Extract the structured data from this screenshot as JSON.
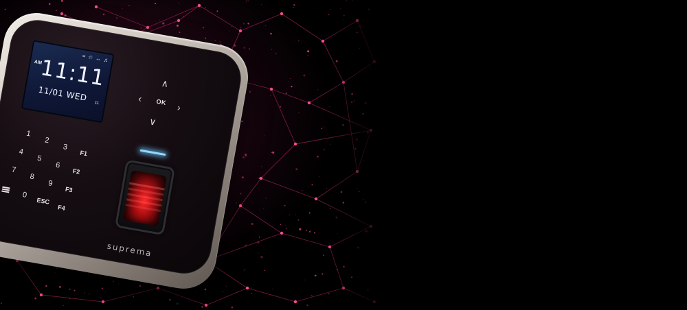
{
  "device": {
    "screen": {
      "ampm": "AM",
      "time": "11:11",
      "date": "11/01 WED",
      "seconds": "11",
      "status_icons": [
        "wifi-icon",
        "star-icon",
        "sync-icon",
        "bell-icon"
      ]
    },
    "navigation": {
      "ok_label": "OK",
      "up": "up-arrow-icon",
      "down": "down-arrow-icon",
      "left": "left-arrow-icon",
      "right": "right-arrow-icon"
    },
    "keypad": {
      "row1": [
        "1",
        "2",
        "3",
        "F1"
      ],
      "row2": [
        "4",
        "5",
        "6",
        "F2"
      ],
      "row3": [
        "7",
        "8",
        "9",
        "F3"
      ],
      "row4": [
        "0",
        "ESC",
        "F4"
      ],
      "menu_icon": "menu-icon"
    },
    "brand": "suprema",
    "sensor_color": "#ff2a2a",
    "led_color": "#8fd9ff"
  },
  "background": {
    "accent_color": "#e0307a",
    "base_color": "#000000"
  }
}
